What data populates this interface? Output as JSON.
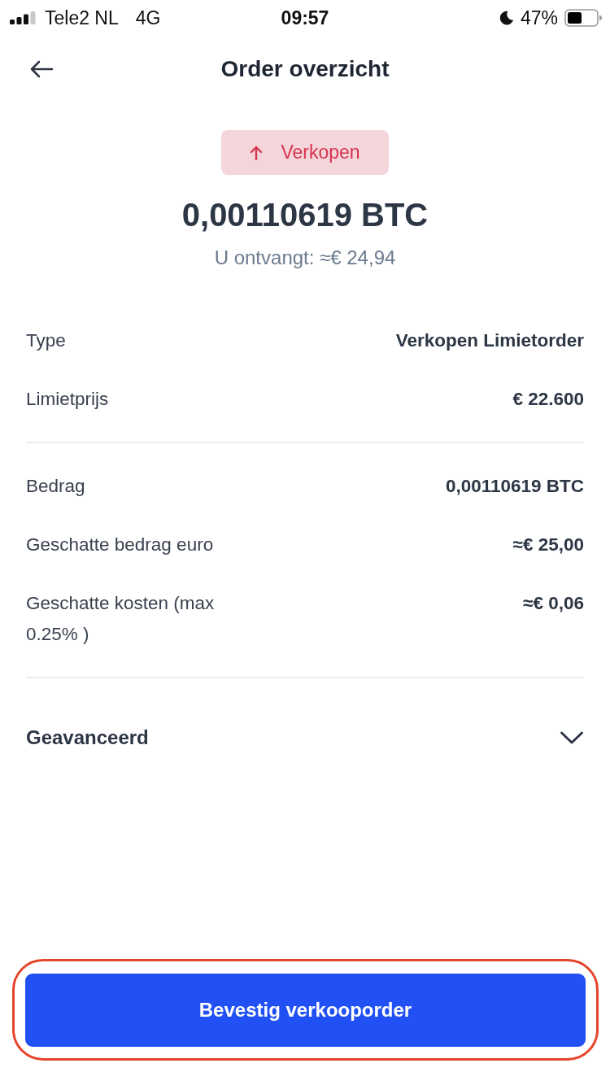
{
  "status_bar": {
    "carrier": "Tele2 NL",
    "network": "4G",
    "time": "09:57",
    "battery": "47%"
  },
  "header": {
    "title": "Order overzicht"
  },
  "summary": {
    "badge": {
      "label": "Verkopen",
      "kind": "sell"
    },
    "amount": "0,00110619 BTC",
    "receive": "U ontvangt: ≈€ 24,94"
  },
  "details": [
    {
      "rows": [
        {
          "label": "Type",
          "value": "Verkopen Limietorder"
        },
        {
          "label": "Limietprijs",
          "value": "€ 22.600"
        }
      ]
    },
    {
      "rows": [
        {
          "label": "Bedrag",
          "value": "0,00110619 BTC"
        },
        {
          "label": "Geschatte bedrag euro",
          "value": "≈€ 25,00"
        },
        {
          "label": "Geschatte kosten (max 0.25% )",
          "value": "≈€ 0,06"
        }
      ]
    }
  ],
  "advanced": {
    "label": "Geavanceerd",
    "expanded": false
  },
  "confirm_button": {
    "label": "Bevestig verkooporder",
    "highlighted": true
  }
}
